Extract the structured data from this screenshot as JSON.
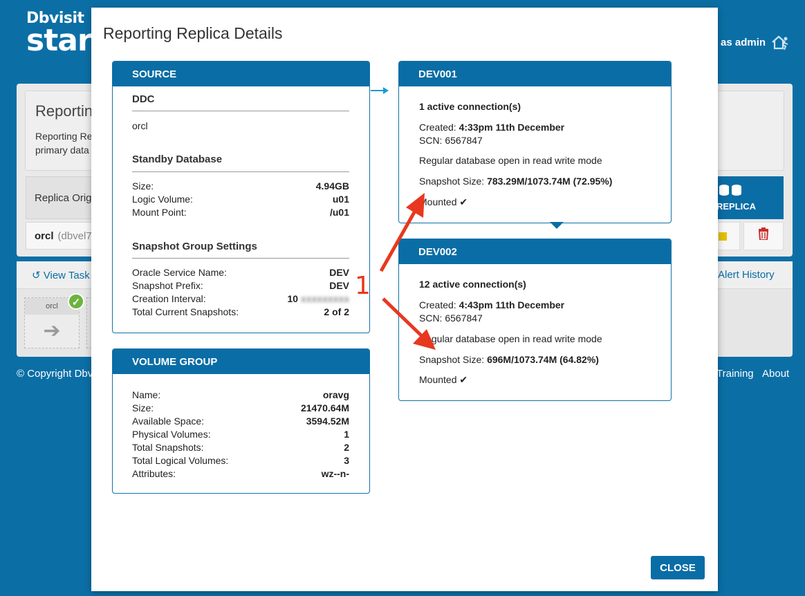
{
  "background": {
    "logo_line1": "Dbvisit",
    "logo_line2": "star",
    "user_text": "as admin",
    "intro_title": "Reportin",
    "intro_desc": "Reporting Re primary data",
    "replica_origin": "Replica Orig",
    "orcl_label": "orcl",
    "orcl_host": "(dbvel7",
    "replica_button": "REPLICA",
    "view_tasks": "View Task",
    "alert_history": "Alert History",
    "tile_label": "orcl",
    "copyright": "© Copyright Dbv",
    "training": "Training",
    "about": "About"
  },
  "modal": {
    "title": "Reporting Replica Details",
    "close_label": "CLOSE",
    "source": {
      "header": "SOURCE",
      "ddc_title": "DDC",
      "ddc_value": "orcl",
      "standby_title": "Standby Database",
      "standby_rows": [
        {
          "k": "Size:",
          "v": "4.94GB"
        },
        {
          "k": "Logic Volume:",
          "v": "u01"
        },
        {
          "k": "Mount Point:",
          "v": "/u01"
        }
      ],
      "snapshot_title": "Snapshot Group Settings",
      "snapshot_rows": [
        {
          "k": "Oracle Service Name:",
          "v": "DEV"
        },
        {
          "k": "Snapshot Prefix:",
          "v": "DEV"
        },
        {
          "k": "Creation Interval:",
          "v": "10"
        },
        {
          "k": "Total Current Snapshots:",
          "v": "2 of 2"
        }
      ]
    },
    "volume_group": {
      "header": "VOLUME GROUP",
      "rows": [
        {
          "k": "Name:",
          "v": "oravg"
        },
        {
          "k": "Size:",
          "v": "21470.64M"
        },
        {
          "k": "Available Space:",
          "v": "3594.52M"
        },
        {
          "k": "Physical Volumes:",
          "v": "1"
        },
        {
          "k": "Total Snapshots:",
          "v": "2"
        },
        {
          "k": "Total Logical Volumes:",
          "v": "3"
        },
        {
          "k": "Attributes:",
          "v": "wz--n-"
        }
      ]
    },
    "dev001": {
      "header": "DEV001",
      "connections": "1 active connection(s)",
      "created_label": "Created:",
      "created_value": "4:33pm 11th December",
      "scn": "SCN: 6567847",
      "mode": "Regular database open in read write mode",
      "snapshot_label": "Snapshot Size:",
      "snapshot_value": "783.29M/1073.74M (72.95%)",
      "mounted": "Mounted"
    },
    "dev002": {
      "header": "DEV002",
      "connections": "12 active connection(s)",
      "created_label": "Created:",
      "created_value": "4:43pm 11th December",
      "scn": "SCN: 6567847",
      "mode": "Regular database open in read write mode",
      "snapshot_label": "Snapshot Size:",
      "snapshot_value": "696M/1073.74M (64.82%)",
      "mounted": "Mounted"
    },
    "annotation_number": "1"
  },
  "colors": {
    "brand": "#0a6da5",
    "annotation": "#e8381f"
  }
}
